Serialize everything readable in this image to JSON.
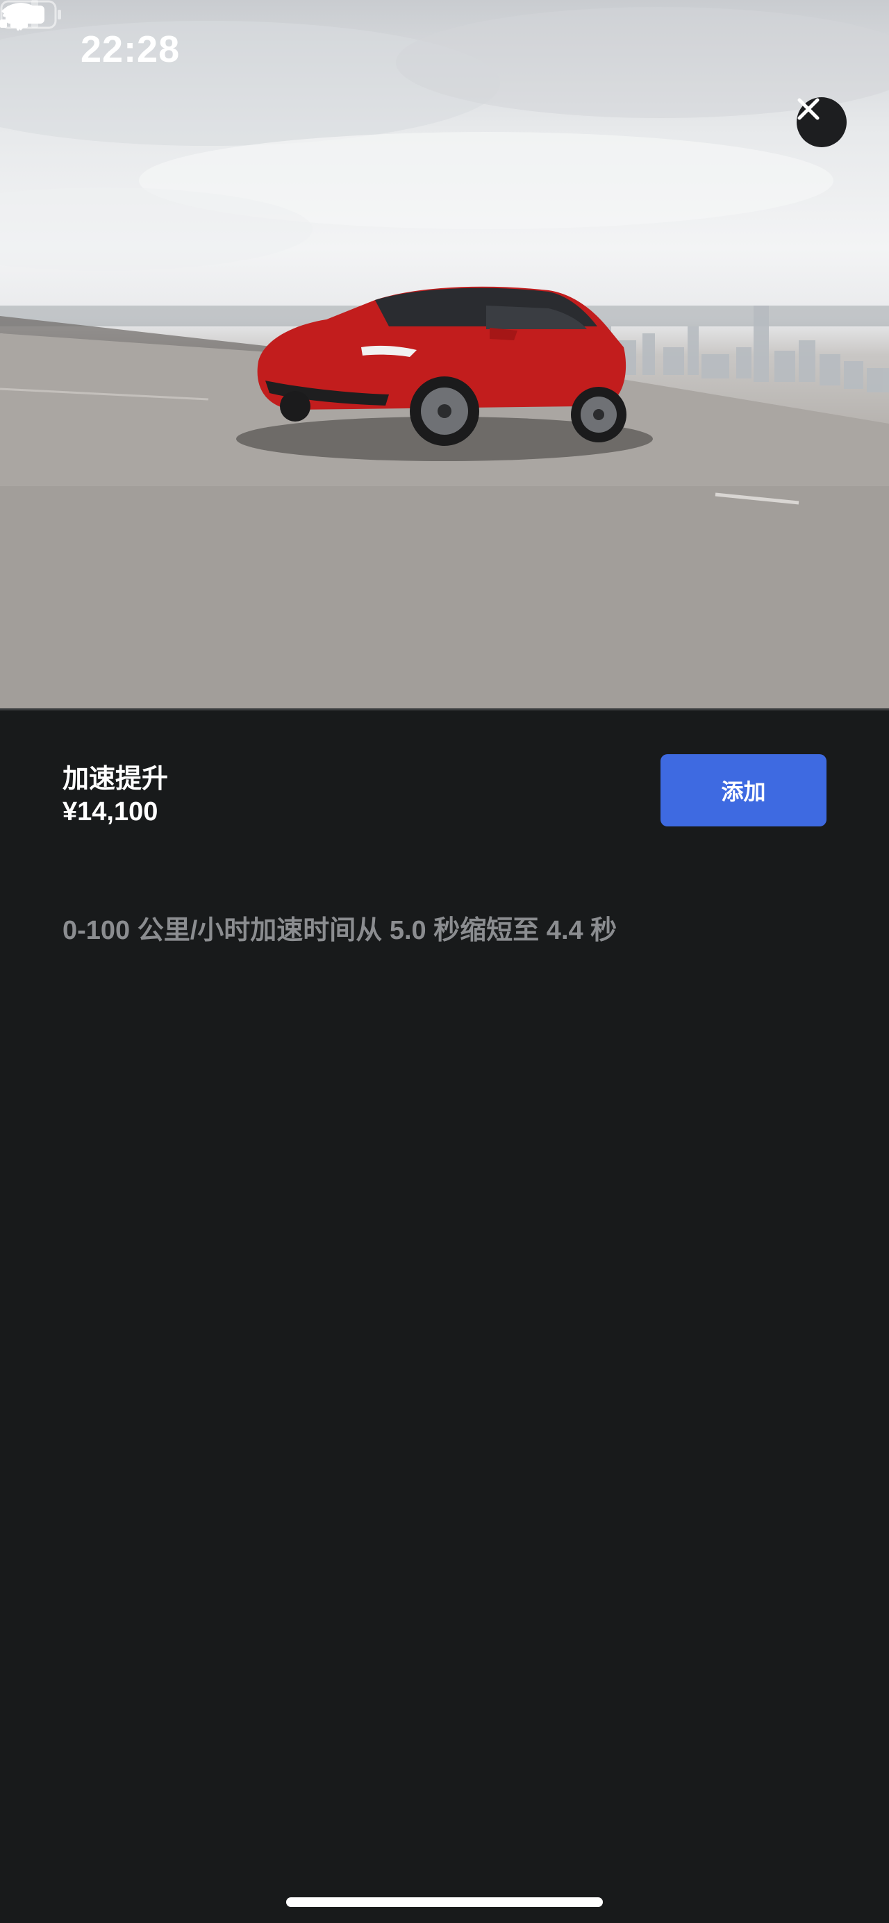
{
  "status_bar": {
    "time": "22:28",
    "icons": [
      "location-arrow-icon",
      "cellular-signal-icon",
      "wifi-icon",
      "battery-icon"
    ]
  },
  "hero": {
    "image_subject": "red car driving on road with city skyline",
    "close_icon": "close-icon"
  },
  "option": {
    "title": "加速提升",
    "price": "¥14,100",
    "add_label": "添加",
    "description": "0-100 公里/小时加速时间从 5.0 秒缩短至 4.4 秒"
  },
  "colors": {
    "background": "#181a1b",
    "accent": "#3e6ae1",
    "text_primary": "#ffffff",
    "text_secondary": "#8b8d90",
    "car_red": "#c21d1d"
  }
}
